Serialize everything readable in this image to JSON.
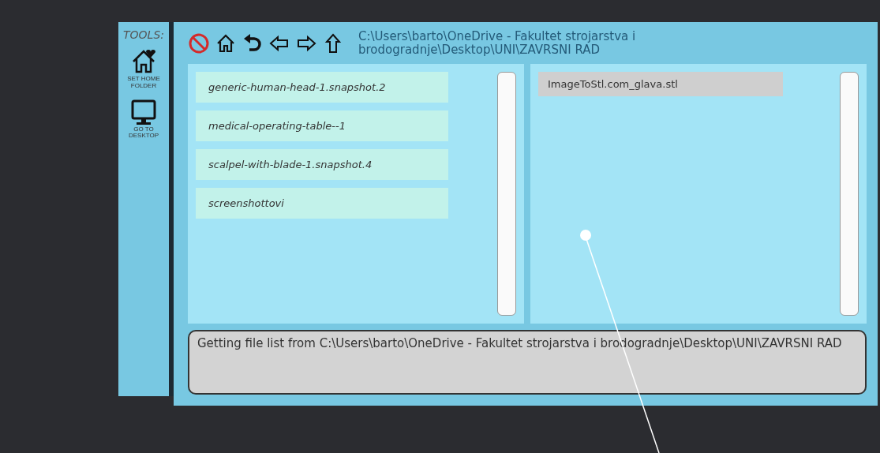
{
  "sidebar": {
    "title": "TOOLS:",
    "items": [
      {
        "kind": "home",
        "label": "SET HOME FOLDER"
      },
      {
        "kind": "desktop",
        "label": "GO TO DESKTOP"
      }
    ]
  },
  "toolbar": {
    "buttons": [
      {
        "kind": "cancel"
      },
      {
        "kind": "home"
      },
      {
        "kind": "undo"
      },
      {
        "kind": "back"
      },
      {
        "kind": "forward"
      },
      {
        "kind": "up"
      }
    ],
    "path": "C:\\Users\\barto\\OneDrive - Fakultet strojarstva i brodogradnje\\Desktop\\UNI\\ZAVRSNI RAD"
  },
  "folders": [
    {
      "name": "generic-human-head-1.snapshot.2",
      "selected": false
    },
    {
      "name": "medical-operating-table--1",
      "selected": false
    },
    {
      "name": "scalpel-with-blade-1.snapshot.4",
      "selected": false
    },
    {
      "name": "screenshottovi",
      "selected": false
    }
  ],
  "files": [
    {
      "name": "ImageToStl.com_glava.stl",
      "selected": true
    }
  ],
  "status": "Getting file list from C:\\Users\\barto\\OneDrive - Fakultet strojarstva i brodogradnje\\Desktop\\UNI\\ZAVRSNI RAD"
}
